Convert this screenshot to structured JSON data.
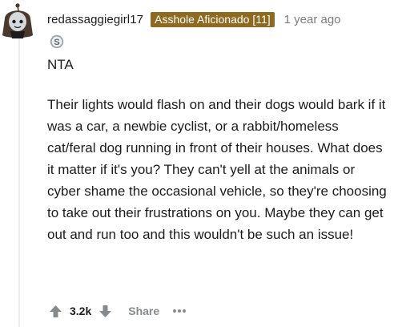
{
  "comment": {
    "username": "redassaggiegirl17",
    "flair": "Asshole Aficionado [11]",
    "timestamp": "1 year ago",
    "award_icon": "silver-award-icon",
    "verdict": "NTA",
    "text": "Their lights would flash on and their dogs would bark if it was a car, a newbie cyclist, or a rabbit/homeless cat/feral dog running in front of their houses. What does it matter if it's you? They can't yell at the animals or cyber shame the occasional vehicle, so they're choosing to take out their frustrations on you. Maybe they can get out and run too and this wouldn't be such an issue!",
    "score": "3.2k",
    "share_label": "Share",
    "more_label": "•••"
  },
  "colors": {
    "flair_background": "#8d6a1f",
    "text": "#1c1c1c",
    "meta": "#7c7c7c",
    "action": "#878a8c",
    "vote_icon": "#878a8c"
  }
}
